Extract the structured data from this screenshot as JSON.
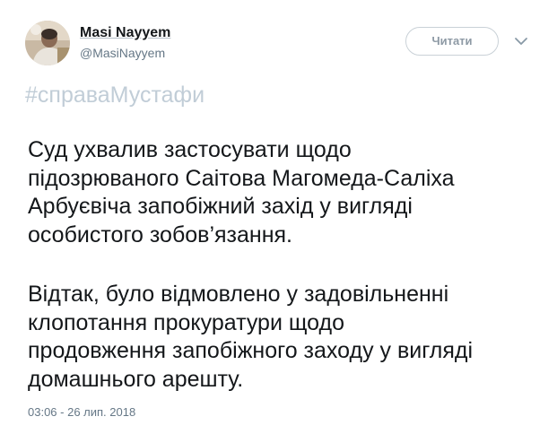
{
  "author": {
    "display_name": "Masi Nayyem",
    "username": "@MasiNayyem"
  },
  "actions": {
    "follow_label": "Читати",
    "more_icon": "chevron-down-icon"
  },
  "tweet": {
    "hashtag": "#справаМустафи",
    "paragraph1": {
      "lines": [
        "Суд ухвалив застосувати щодо",
        "підозрюваного Саітова Магомеда-Саліха",
        "Арбуєвіча запобіжний захід у вигляді",
        "особистого зобов’язання."
      ]
    },
    "paragraph2": {
      "lines": [
        "Відтак, було відмовлено у задовільненні",
        "клопотання прокуратури щодо",
        "продовження запобіжного заходу у вигляді",
        "домашнього арешту."
      ]
    },
    "timestamp": "03:06 - 26 лип. 2018"
  },
  "colors": {
    "text": "#14171a",
    "secondary": "#657786",
    "hashtag": "#c1cdd7",
    "button_border": "#c9d1d7"
  }
}
